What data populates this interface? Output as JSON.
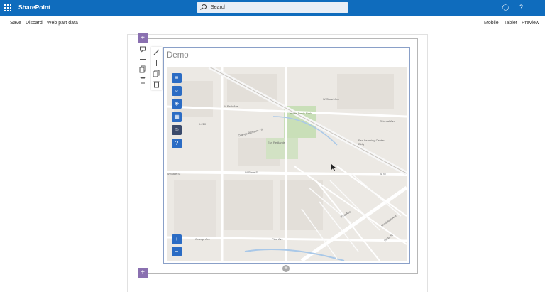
{
  "header": {
    "brand": "SharePoint",
    "search_placeholder": "Search",
    "settings_icon": "gear-icon",
    "help_glyph": "?"
  },
  "command_bar": {
    "left": [
      "Save",
      "Discard",
      "Web part data"
    ],
    "right": [
      "Mobile",
      "Tablet",
      "Preview"
    ]
  },
  "section_toolbar": {
    "icons": [
      "edit-section-icon",
      "move-icon",
      "duplicate-icon",
      "delete-icon"
    ]
  },
  "webpart_toolbar": {
    "icons": [
      "pencil-icon",
      "move-icon",
      "copy-icon",
      "trash-icon"
    ]
  },
  "webpart": {
    "title": "Demo"
  },
  "map": {
    "widget_buttons": [
      "menu-icon",
      "search-icon",
      "layers-icon",
      "basemap-gallery-icon",
      "avatar-icon",
      "help-icon"
    ],
    "zoom_in": "+",
    "zoom_out": "−",
    "help_glyph": "?",
    "labels": {
      "park": "W Park Ave",
      "stuart": "W Stuart Ave",
      "oriental": "Oriental Ave",
      "state": "W State St",
      "state2": "W State St",
      "orange_blossom": "Orange Blossom Trl",
      "esri": "Esri Redlands",
      "esri_learning": "Esri Learning Center - Bldg",
      "pine": "Pine Ave",
      "orange": "Orange Ave",
      "pine2": "Pine Ave",
      "linda": "Linda St",
      "brookside": "Brookside Ave",
      "jennie": "Jennie Davis Park",
      "i210": "I-210",
      "w_st": "W St"
    }
  },
  "add_glyph": "+"
}
